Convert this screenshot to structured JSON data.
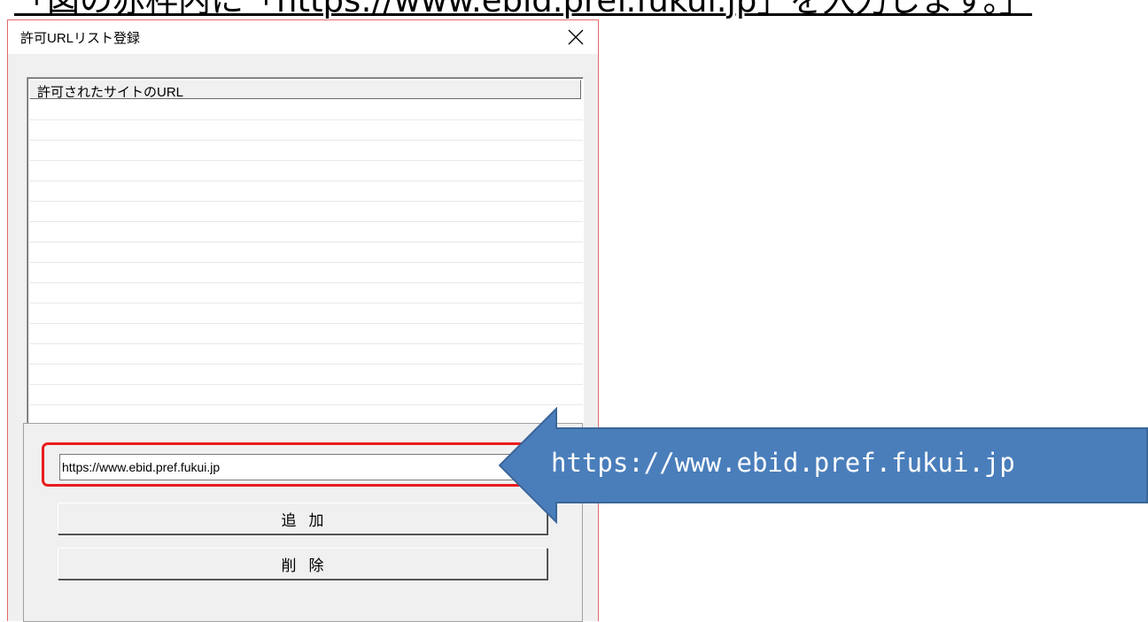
{
  "caption": {
    "text": "「図の赤枠内に「https://www.ebid.pref.fukui.jp」を入力します。」"
  },
  "window": {
    "title": "許可URLリスト登録",
    "close_label": "✕"
  },
  "list": {
    "header": "許可されたサイトのURL",
    "items": []
  },
  "input": {
    "value": "https://www.ebid.pref.fukui.jp",
    "placeholder": ""
  },
  "buttons": {
    "add_label": "追加",
    "delete_label": "削除"
  },
  "callout": {
    "text": "https://www.ebid.pref.fukui.jp"
  },
  "colors": {
    "highlight": "#ea1c1c",
    "callout_fill": "#4a7ebb",
    "callout_border": "#3a6699"
  }
}
